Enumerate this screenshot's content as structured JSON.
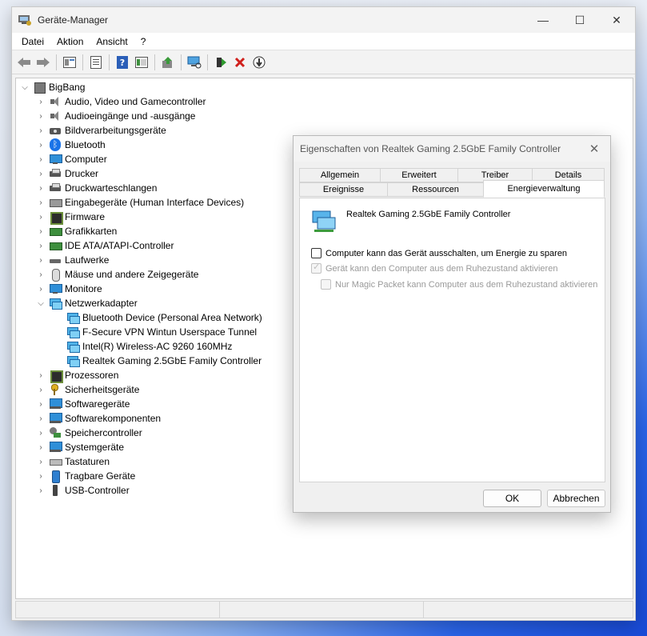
{
  "window": {
    "title": "Geräte-Manager",
    "controls": [
      "—",
      "☐",
      "✕"
    ]
  },
  "menu": {
    "items": [
      "Datei",
      "Aktion",
      "Ansicht",
      "?"
    ]
  },
  "toolbar": {
    "buttons": [
      "back-icon",
      "forward-icon",
      "view-icon",
      "properties-icon",
      "help-icon",
      "console-icon",
      "update-driver-icon",
      "scan-icon",
      "enable-device-icon",
      "uninstall-icon",
      "disable-icon"
    ]
  },
  "tree": {
    "root": "BigBang",
    "categories": [
      {
        "label": "Audio, Video und Gamecontroller",
        "icon": "speaker-icon"
      },
      {
        "label": "Audioeingänge und -ausgänge",
        "icon": "speaker-icon"
      },
      {
        "label": "Bildverarbeitungsgeräte",
        "icon": "camera-icon"
      },
      {
        "label": "Bluetooth",
        "icon": "bluetooth-icon"
      },
      {
        "label": "Computer",
        "icon": "monitor-icon"
      },
      {
        "label": "Drucker",
        "icon": "printer-icon"
      },
      {
        "label": "Druckwarteschlangen",
        "icon": "printer-icon"
      },
      {
        "label": "Eingabegeräte (Human Interface Devices)",
        "icon": "hid-icon"
      },
      {
        "label": "Firmware",
        "icon": "chip-icon"
      },
      {
        "label": "Grafikkarten",
        "icon": "card-icon"
      },
      {
        "label": "IDE ATA/ATAPI-Controller",
        "icon": "card-icon"
      },
      {
        "label": "Laufwerke",
        "icon": "drive-icon"
      },
      {
        "label": "Mäuse und andere Zeigegeräte",
        "icon": "mouse-icon"
      },
      {
        "label": "Monitore",
        "icon": "monitor-icon"
      },
      {
        "label": "Netzwerkadapter",
        "icon": "network-icon",
        "expanded": true
      },
      {
        "label": "Prozessoren",
        "icon": "chip-icon"
      },
      {
        "label": "Sicherheitsgeräte",
        "icon": "key-icon"
      },
      {
        "label": "Softwaregeräte",
        "icon": "sys-icon"
      },
      {
        "label": "Softwarekomponenten",
        "icon": "sys-icon"
      },
      {
        "label": "Speichercontroller",
        "icon": "storage-icon"
      },
      {
        "label": "Systemgeräte",
        "icon": "sys-icon"
      },
      {
        "label": "Tastaturen",
        "icon": "keyboard-icon"
      },
      {
        "label": "Tragbare Geräte",
        "icon": "portable-icon"
      },
      {
        "label": "USB-Controller",
        "icon": "usb-icon"
      }
    ],
    "network_children": [
      "Bluetooth Device (Personal Area Network)",
      "F-Secure VPN Wintun Userspace Tunnel",
      "Intel(R) Wireless-AC 9260 160MHz",
      "Realtek Gaming 2.5GbE Family Controller"
    ]
  },
  "dialog": {
    "title": "Eigenschaften von Realtek Gaming 2.5GbE Family Controller",
    "close": "✕",
    "tabs_row1": [
      "Allgemein",
      "Erweitert",
      "Treiber",
      "Details"
    ],
    "tabs_row2": [
      "Ereignisse",
      "Ressourcen",
      "Energieverwaltung"
    ],
    "active_tab": "Energieverwaltung",
    "device_name": "Realtek Gaming 2.5GbE Family Controller",
    "options": [
      {
        "label": "Computer kann das Gerät ausschalten, um Energie zu sparen",
        "checked": false,
        "enabled": true
      },
      {
        "label": "Gerät kann den Computer aus dem Ruhezustand aktivieren",
        "checked": true,
        "enabled": false
      },
      {
        "label": "Nur Magic Packet kann Computer aus dem Ruhezustand aktivieren",
        "checked": false,
        "enabled": false
      }
    ],
    "ok_label": "OK",
    "cancel_label": "Abbrechen"
  }
}
